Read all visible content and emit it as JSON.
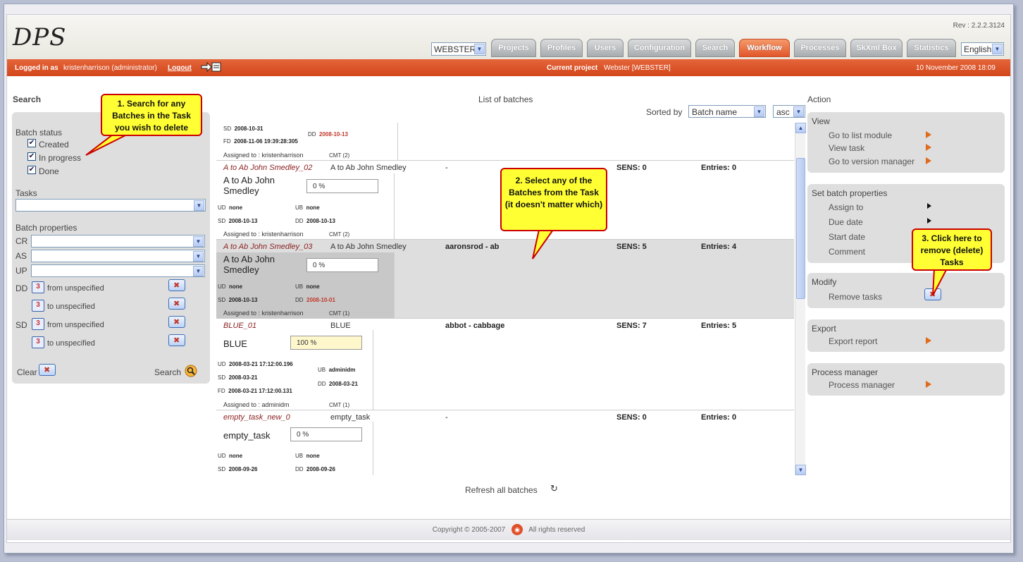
{
  "app": {
    "logo": "DPS",
    "revision": "Rev : 2.2.2.3124"
  },
  "header": {
    "project_select": "WEBSTER",
    "tabs": [
      {
        "label": "Projects",
        "active": false
      },
      {
        "label": "Profiles",
        "active": false
      },
      {
        "label": "Users",
        "active": false
      },
      {
        "label": "Configuration",
        "active": false
      },
      {
        "label": "Search",
        "active": false
      },
      {
        "label": "Workflow",
        "active": true
      },
      {
        "label": "Processes",
        "active": false
      },
      {
        "label": "SkXml Box",
        "active": false
      },
      {
        "label": "Statistics",
        "active": false
      }
    ],
    "language": "English"
  },
  "status_bar": {
    "logged_in_label": "Logged in as",
    "user": "kristenharrison (administrator)",
    "logout": "Logout",
    "current_project_label": "Current project",
    "current_project": "Webster [WEBSTER]",
    "date": "10 November 2008 18:09"
  },
  "search": {
    "title": "Search",
    "batch_status_label": "Batch status",
    "statuses": [
      "Created",
      "In progress",
      "Done"
    ],
    "tasks_label": "Tasks",
    "batch_props_label": "Batch properties",
    "props": [
      "CR",
      "AS",
      "UP"
    ],
    "dd_label": "DD",
    "sd_label": "SD",
    "from_text": "from unspecified",
    "to_text": "to unspecified",
    "cal_text": "3",
    "clear": "Clear",
    "search": "Search"
  },
  "list": {
    "title": "List of batches",
    "sorted_by": "Sorted by",
    "sort_field": "Batch name",
    "sort_order": "asc",
    "refresh": "Refresh all batches",
    "labels": {
      "sens": "SENS:",
      "entries": "Entries:",
      "ud": "UD",
      "ub": "UB",
      "sd": "SD",
      "dd": "DD",
      "fd": "FD",
      "cmt": "CMT",
      "assigned": "Assigned to :"
    },
    "partial_row": {
      "sd": "2008-10-31",
      "fd": "2008-11-06 19:39:28:305",
      "dd": "2008-10-13",
      "assigned": "Assigned to : kristenharrison",
      "cmt": "CMT (2)"
    },
    "rows": [
      {
        "name": "A to Ab John Smedley_02",
        "task": "A to Ab John Smedley",
        "range": "-",
        "sens": "SENS: 0",
        "entries": "Entries: 0",
        "big": "A to Ab John Smedley",
        "pct": "0 %",
        "ud": "none",
        "ub": "none",
        "sd": "2008-10-13",
        "dd": "2008-10-13",
        "assigned": "Assigned to : kristenharrison",
        "cmt": "CMT (2)"
      },
      {
        "name": "A to Ab John Smedley_03",
        "task": "A to Ab John Smedley",
        "range": "aaronsrod - ab",
        "sens": "SENS: 5",
        "entries": "Entries: 4",
        "big": "A to Ab John Smedley",
        "pct": "0 %",
        "ud": "none",
        "ub": "none",
        "sd": "2008-10-13",
        "dd": "2008-10-01",
        "assigned": "Assigned to : kristenharrison",
        "cmt": "CMT (1)"
      },
      {
        "name": "BLUE_01",
        "task": "BLUE",
        "range": "abbot - cabbage",
        "sens": "SENS: 7",
        "entries": "Entries: 5",
        "big": "BLUE",
        "pct": "100 %",
        "ud": "2008-03-21 17:12:00.196",
        "ub": "adminidm",
        "sd": "2008-03-21",
        "dd": "2008-03-21",
        "fd": "2008-03-21 17:12:00.131",
        "assigned": "Assigned to : adminidm",
        "cmt": "CMT (1)"
      },
      {
        "name": "empty_task_new_0",
        "task": "empty_task",
        "range": "-",
        "sens": "SENS: 0",
        "entries": "Entries: 0",
        "big": "empty_task",
        "pct": "0 %",
        "ud": "none",
        "ub": "none",
        "sd": "2008-09-26",
        "dd": "2008-09-26"
      }
    ]
  },
  "action": {
    "title": "Action",
    "view": {
      "h": "View",
      "items": [
        "Go to list module",
        "View task",
        "Go to version manager"
      ]
    },
    "set_props": {
      "h": "Set batch properties",
      "items": [
        "Assign to",
        "Due date",
        "Start date",
        "Comment"
      ]
    },
    "modify": {
      "h": "Modify",
      "items": [
        "Remove tasks"
      ]
    },
    "export": {
      "h": "Export",
      "items": [
        "Export report"
      ]
    },
    "process": {
      "h": "Process manager",
      "items": [
        "Process manager"
      ]
    }
  },
  "callouts": {
    "c1": "1. Search for any Batches in the Task you wish to delete",
    "c2": "2. Select any of the Batches from the Task (it doesn't matter which)",
    "c3": "3. Click here to remove (delete) Tasks"
  },
  "footer": {
    "copyright": "Copyright © 2005-2007",
    "rights": "All rights reserved"
  },
  "colors": {
    "accent": "#d9502a",
    "highlight": "#ffff33",
    "callout_border": "#cc0000"
  }
}
